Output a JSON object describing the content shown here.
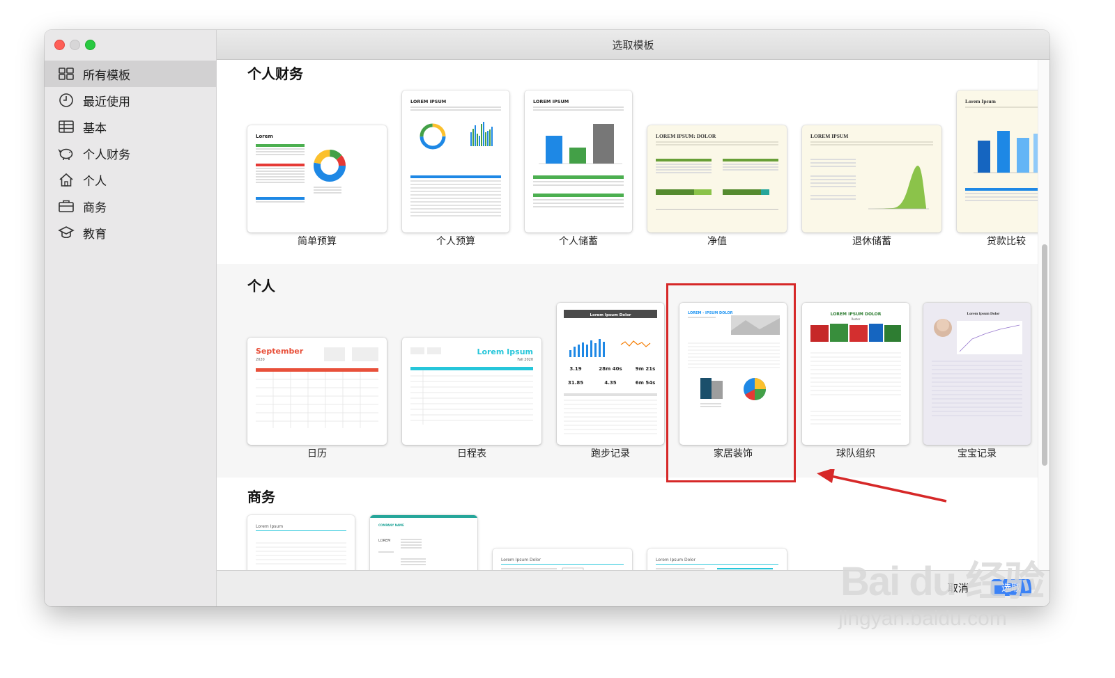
{
  "window": {
    "title": "选取模板"
  },
  "sidebar": {
    "items": [
      {
        "label": "所有模板",
        "icon": "grid-icon",
        "active": true
      },
      {
        "label": "最近使用",
        "icon": "clock-icon"
      },
      {
        "label": "基本",
        "icon": "table-icon"
      },
      {
        "label": "个人财务",
        "icon": "piggy-bank-icon"
      },
      {
        "label": "个人",
        "icon": "house-icon"
      },
      {
        "label": "商务",
        "icon": "briefcase-icon"
      },
      {
        "label": "教育",
        "icon": "graduation-cap-icon"
      }
    ]
  },
  "sections": [
    {
      "title": "个人财务",
      "templates": [
        {
          "label": "简单预算",
          "thumb_text": "Lorem"
        },
        {
          "label": "个人预算",
          "thumb_text": "LOREM IPSUM"
        },
        {
          "label": "个人储蓄",
          "thumb_text": "LOREM IPSUM"
        },
        {
          "label": "净值",
          "thumb_text": "LOREM IPSUM: DOLOR"
        },
        {
          "label": "退休储蓄",
          "thumb_text": "LOREM IPSUM"
        },
        {
          "label": "贷款比较",
          "thumb_text": "Lorem Ipsum"
        }
      ]
    },
    {
      "title": "个人",
      "templates": [
        {
          "label": "日历",
          "thumb_text": "September",
          "thumb_sub": "2020"
        },
        {
          "label": "日程表",
          "thumb_text": "Lorem Ipsum",
          "thumb_sub": "Fall 2020"
        },
        {
          "label": "跑步记录",
          "thumb_text": "Lorem Ipsum Dolor",
          "stats": [
            "3.19",
            "28m 40s",
            "9m 21s",
            "31.85",
            "4.35",
            "6m 54s"
          ]
        },
        {
          "label": "家居装饰",
          "thumb_text": "LOREM - IPSUM DOLOR"
        },
        {
          "label": "球队组织",
          "thumb_text": "LOREM IPSUM DOLOR",
          "thumb_sub": "Roster"
        },
        {
          "label": "宝宝记录",
          "thumb_text": "Lorem Ipsum Dolor"
        }
      ]
    },
    {
      "title": "商务",
      "templates": [
        {
          "thumb_text": "Lorem Ipsum"
        },
        {
          "thumb_text": "COMPANY NAME",
          "thumb_sub": "LOREM"
        },
        {
          "thumb_text": "Lorem Ipsum Dolor"
        },
        {
          "thumb_text": "Lorem Ipsum Dolor"
        }
      ]
    }
  ],
  "footer": {
    "cancel_label": "取消",
    "choose_label": "选取"
  },
  "watermark": {
    "logo": "Bai du 经验",
    "url": "jingyan.baidu.com"
  },
  "colors": {
    "highlight": "#d62828",
    "accent": "#3b82f6"
  }
}
